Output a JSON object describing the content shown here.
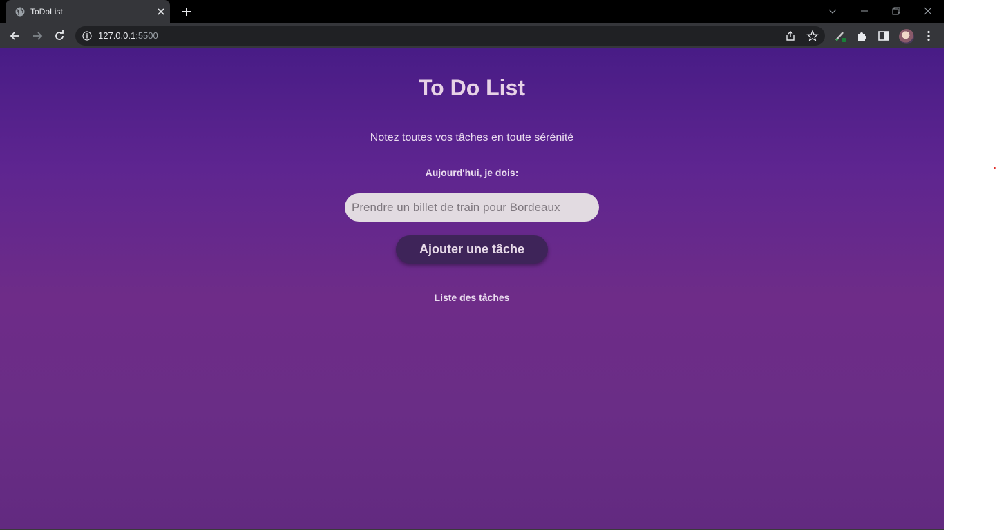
{
  "browser": {
    "tab_title": "ToDoList",
    "url_host": "127.0.0.1",
    "url_port": ":5500"
  },
  "page": {
    "title": "To Do List",
    "subtitle": "Notez toutes vos tâches en toute sérénité",
    "today_label": "Aujourd'hui, je dois:",
    "task_input_placeholder": "Prendre un billet de train pour Bordeaux",
    "task_input_value": "",
    "add_button_label": "Ajouter une tâche",
    "list_title": "Liste des tâches"
  },
  "colors": {
    "accent": "#3e2459",
    "background_top": "#481c86",
    "background_middle": "#6e2c88"
  }
}
